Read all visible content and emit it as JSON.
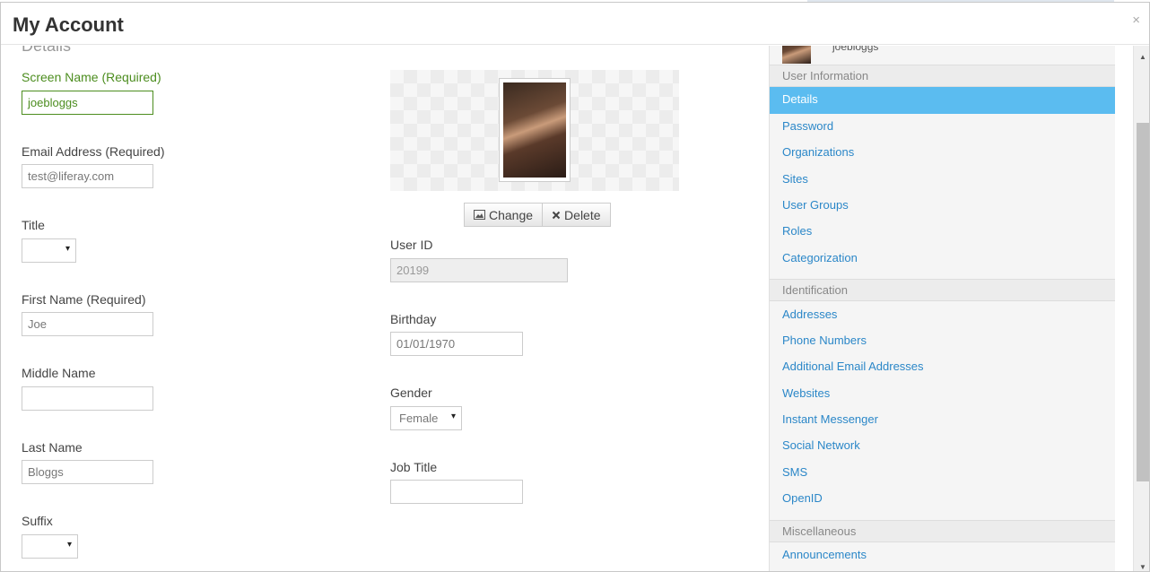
{
  "modal": {
    "title": "My Account",
    "close": "×"
  },
  "details": {
    "section_title": "Details",
    "screen_name": {
      "label": "Screen Name (Required)",
      "value": "joebloggs"
    },
    "email": {
      "label": "Email Address (Required)",
      "placeholder": "test@liferay.com"
    },
    "title": {
      "label": "Title",
      "value": ""
    },
    "first_name": {
      "label": "First Name (Required)",
      "placeholder": "Joe"
    },
    "middle_name": {
      "label": "Middle Name",
      "value": ""
    },
    "last_name": {
      "label": "Last Name",
      "placeholder": "Bloggs"
    },
    "suffix": {
      "label": "Suffix",
      "value": ""
    },
    "photo": {
      "change": "Change",
      "delete": "Delete"
    },
    "user_id": {
      "label": "User ID",
      "value": "20199"
    },
    "birthday": {
      "label": "Birthday",
      "value": "01/01/1970"
    },
    "gender": {
      "label": "Gender",
      "value": "Female"
    },
    "job_title": {
      "label": "Job Title",
      "value": ""
    }
  },
  "sidebar": {
    "user_name": "joebloggs",
    "sections": [
      {
        "header": "User Information",
        "items": [
          "Details",
          "Password",
          "Organizations",
          "Sites",
          "User Groups",
          "Roles",
          "Categorization"
        ]
      },
      {
        "header": "Identification",
        "items": [
          "Addresses",
          "Phone Numbers",
          "Additional Email Addresses",
          "Websites",
          "Instant Messenger",
          "Social Network",
          "SMS",
          "OpenID"
        ]
      },
      {
        "header": "Miscellaneous",
        "items": [
          "Announcements"
        ]
      }
    ],
    "active": "Details"
  },
  "icons": {
    "caret": "▾",
    "image": "image-icon",
    "delete": "x-icon"
  }
}
